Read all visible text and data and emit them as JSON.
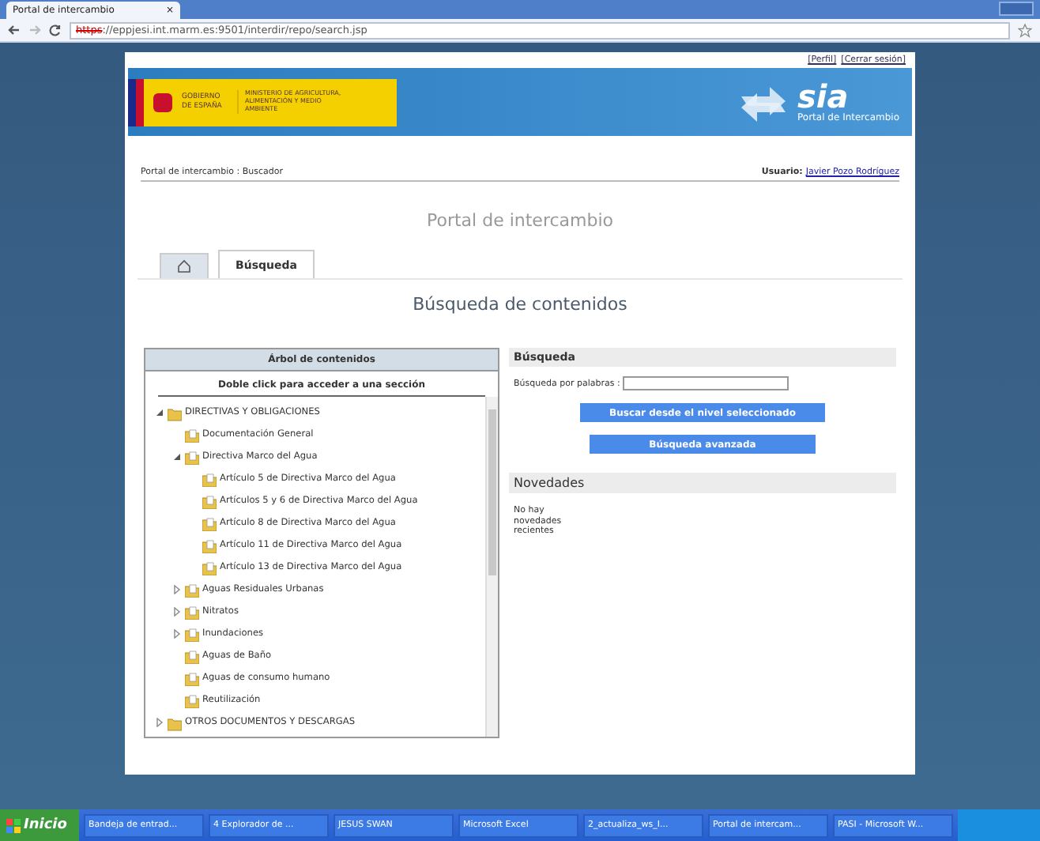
{
  "browser": {
    "tab": {
      "title": "Portal de intercambio",
      "close": "×"
    },
    "address": {
      "scheme": "https",
      "rest": "://eppjesi.int.marm.es:9501/interdir/repo/search.jsp"
    }
  },
  "top_links": [
    "[Perfil]",
    "[Cerrar sesión]"
  ],
  "banner": {
    "gov": "GOBIERNO DE ESPAÑA",
    "ministry": "MINISTERIO DE AGRICULTURA, ALIMENTACIÓN Y MEDIO AMBIENTE",
    "logo": "sia",
    "portal": "Portal de Intercambio"
  },
  "breadcrumb": "Portal de intercambio : Buscador",
  "user": {
    "label": "Usuario:",
    "name": "Javier Pozo Rodríguez"
  },
  "title": "Portal de intercambio",
  "tabs": [
    {
      "kind": "home",
      "selected": false
    },
    {
      "kind": "text",
      "label": "Búsqueda",
      "selected": true
    }
  ],
  "heading": "Búsqueda de contenidos",
  "tree": {
    "title": "Árbol de contenidos",
    "hint": "Doble click para acceder a una sección",
    "items": [
      {
        "label": "DIRECTIVAS Y OBLIGACIONES",
        "expanded": true,
        "children": [
          {
            "label": "Documentación General"
          },
          {
            "label": "Directiva Marco del Agua",
            "expanded": true,
            "children": [
              {
                "label": "Artículo 5 de Directiva Marco del Agua"
              },
              {
                "label": "Artículos 5 y 6 de Directiva Marco del Agua"
              },
              {
                "label": "Artículo 8 de Directiva Marco del Agua"
              },
              {
                "label": "Artículo 11 de Directiva Marco del Agua"
              },
              {
                "label": "Artículo 13 de Directiva Marco del Agua"
              }
            ]
          },
          {
            "label": "Aguas Residuales Urbanas",
            "expanded": false
          },
          {
            "label": "Nitratos",
            "expanded": false
          },
          {
            "label": "Inundaciones",
            "expanded": false
          },
          {
            "label": "Aguas de Baño"
          },
          {
            "label": "Aguas de consumo humano"
          },
          {
            "label": "Reutilización"
          }
        ]
      },
      {
        "label": "OTROS DOCUMENTOS Y DESCARGAS",
        "expanded": false
      }
    ]
  },
  "search": {
    "title": "Búsqueda",
    "field_label": "Búsqueda por palabras :",
    "buttons": [
      "Buscar desde el nivel seleccionado",
      "Búsqueda avanzada"
    ]
  },
  "news": {
    "title": "Novedades",
    "text": "No hay novedades recientes"
  },
  "taskbar": {
    "start": "Inicio",
    "items": [
      "Bandeja de entrad...",
      "4 Explorador de ...",
      "JESUS SWAN",
      "Microsoft Excel",
      "2_actualiza_ws_I...",
      "Portal de intercam...",
      "PASI - Microsoft W..."
    ]
  }
}
